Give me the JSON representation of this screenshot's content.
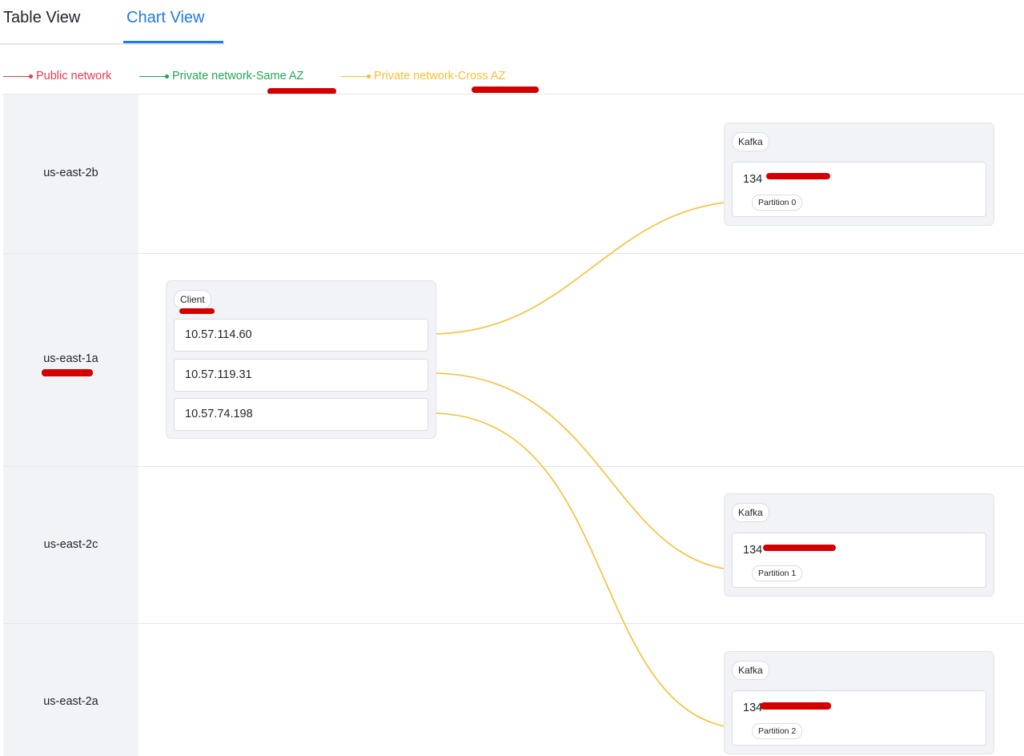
{
  "tabs": [
    {
      "label": "Table View",
      "active": false
    },
    {
      "label": "Chart View",
      "active": true
    }
  ],
  "legend": [
    {
      "label": "Public network",
      "color": "#f0384f"
    },
    {
      "label": "Private network-Same AZ",
      "color": "#23a55a"
    },
    {
      "label": "Private network-Cross AZ",
      "color": "#f8be34"
    }
  ],
  "zones": [
    {
      "name": "us-east-2b"
    },
    {
      "name": "us-east-1a"
    },
    {
      "name": "us-east-2c"
    },
    {
      "name": "us-east-2a"
    }
  ],
  "client": {
    "tag": "Client",
    "nodes": [
      "10.57.114.60",
      "10.57.119.31",
      "10.57.74.198"
    ]
  },
  "kafka": [
    {
      "tag": "Kafka",
      "ip": "134",
      "partition": "Partition 0"
    },
    {
      "tag": "Kafka",
      "ip": "134",
      "partition": "Partition 1"
    },
    {
      "tag": "Kafka",
      "ip": "134",
      "partition": "Partition 2"
    }
  ],
  "colors": {
    "accent": "#1e7ae8",
    "cross_az": "#f8be34",
    "redaction": "#d40000"
  }
}
